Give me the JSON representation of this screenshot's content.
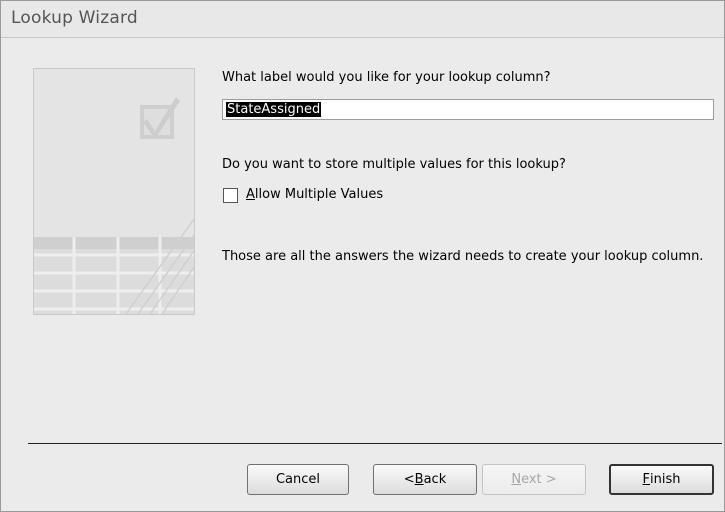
{
  "window": {
    "title": "Lookup Wizard"
  },
  "main": {
    "label_question": "What label would you like for your lookup column?",
    "label_value": "StateAssigned",
    "multi_question": "Do you want to store multiple values for this lookup?",
    "allow_multiple": {
      "accel": "A",
      "rest": "llow Multiple Values",
      "checked": false
    },
    "summary": "Those are all the answers the wizard needs to create your lookup column."
  },
  "buttons": {
    "cancel": "Cancel",
    "back_prefix": "< ",
    "back_accel": "B",
    "back_rest": "ack",
    "next_accel": "N",
    "next_rest": "ext >",
    "finish_accel": "F",
    "finish_rest": "inish"
  },
  "icons": {
    "illustration": "lookup-wizard-illustration",
    "checkmark": "checkmark-icon",
    "table": "table-grid-icon"
  }
}
